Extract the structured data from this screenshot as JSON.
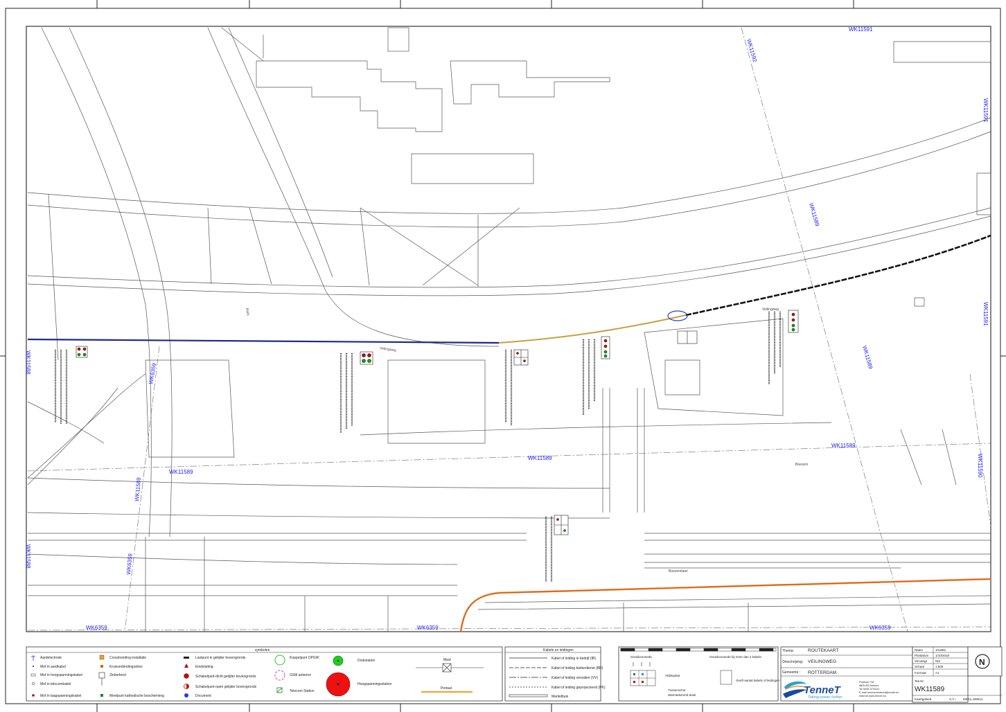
{
  "map": {
    "grid_labels": {
      "wk11591_top": "WK11591",
      "wk11591_right": "WK11591",
      "wk11592": "WK11592",
      "wk11589_diag": "WK11589",
      "wk11589_center": "WK11589",
      "wk11589_left": "WK11589",
      "wk11589_right": "WK11589",
      "wk11589_diag2": "WK11589",
      "wk11589_vert": "WK11589",
      "wk11588_a": "WK11588",
      "wk11588_b": "WK11588",
      "wk11590": "WK11590",
      "wk6359_a": "WK6359",
      "wk6359_b": "WK6359",
      "wk6359_c": "WK6359",
      "wk6359_v": "WK6359",
      "wk6359_v2": "WK6359"
    },
    "streets": {
      "veilingweg_a": "Veilingweg",
      "veilingweg_b": "Veilingweg",
      "boezemlaan": "Boezemlaan",
      "boezem": "Boezem",
      "rails": "Rails"
    }
  },
  "legend": {
    "symbols_title": "symbolen",
    "col1": [
      "Aardelectrode",
      "Mof in aardkabel",
      "Mof in hoogspanningskabel",
      "Mof in telecomkabel",
      "Mof in laagspanningskabel"
    ],
    "col2": [
      "Crossbonding installatie",
      "Kruisverbindingsdoos",
      "Zinkerbord",
      "Meetpunt kathodische bescherming"
    ],
    "col3": [
      "Lastpunt in gelijder bovengronds",
      "Eindsluiting",
      "Schakelpunt-dicht gelijder bovengronds",
      "Schakelpunt-open gelijder bovengronds",
      "Document"
    ],
    "col4": [
      "Koppelpunt OPGW",
      "GSM antenne",
      "Telecom Station"
    ],
    "col5": [
      "Drukstation",
      "Hoogspanningsstation"
    ],
    "col6": [
      "Mast",
      "Portaal"
    ],
    "cables_title": "Kabels en leidingen",
    "cables": [
      "Kabel of leiding in bedrijf (IB)",
      "Kabel of leiding buitendienst (BD)",
      "Kabel of leiding vervallen (VV)",
      "Kabel of leiding geprojecteerd (PK)",
      "Mantelbuis"
    ],
    "detail": {
      "geuldoorsnede": "Geuldoorsnede",
      "geuldoorsnede_meer": "Geuldoorsnede bij meer dan 4 kabels",
      "afdekplaat": "Afdekplaat",
      "geeft_aantal": "Geeft aantal kabels of leidingen weer",
      "tussenschot": "Tussenschot",
      "warmte": "Warmtekerend doek"
    }
  },
  "titleblock": {
    "thema_label": "Thema:",
    "thema_value": "ROUTEKAART",
    "omschrijving_label": "Omschrijving:",
    "omschrijving_value": "VEILINGWEG",
    "gemeente_label": "Gemeente :",
    "gemeente_value": "ROTTERDAM",
    "rows": [
      {
        "label": "Naam",
        "value": "101682"
      },
      {
        "label": "Plotdatum",
        "value": "1/10/2018"
      },
      {
        "label": "Vervangt",
        "value": "Net"
      },
      {
        "label": "Schaal",
        "value": "1:500"
      },
      {
        "label": "Formaat",
        "value": "A1"
      }
    ],
    "teknr_label": "Tek.Nr.",
    "teknr_value": "WK11589",
    "kaartgebied_label": "Kaartgebied",
    "xy_label": "X,Y=",
    "xy_value": "93011,439513",
    "company": "TenneT",
    "tagline": "Taking power further",
    "address": [
      "Postbus 718",
      "6800 AS Arnhem"
    ],
    "contact": [
      "Tel   0026-3731111",
      "E-mail  servicecentrum@tennet.eu",
      "Internet  www.tennet.eu"
    ]
  },
  "compass": "N",
  "colors": {
    "line": "#444444",
    "blue_label": "#1a1aff",
    "cable_blue": "#1a2a88",
    "cable_orange": "#f08020",
    "cable_black": "#111111"
  }
}
